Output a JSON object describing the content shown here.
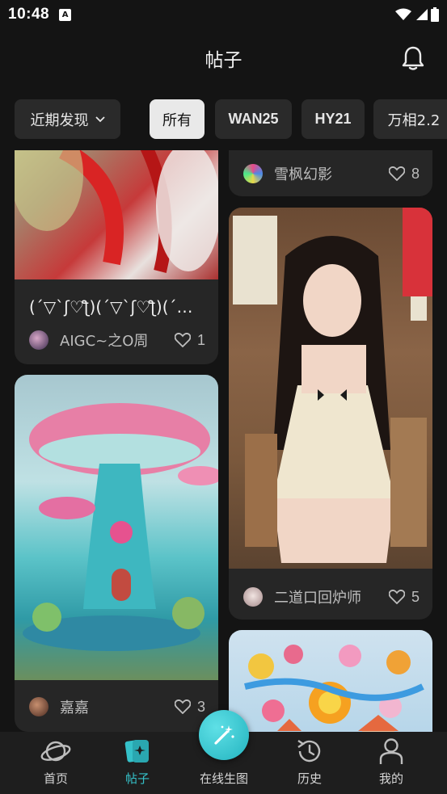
{
  "status_bar": {
    "time": "10:48",
    "app_icon": "A"
  },
  "header": {
    "title": "帖子",
    "notification_icon": "bell-icon"
  },
  "filters": {
    "dropdown_label": "近期发现",
    "chips": [
      "所有",
      "WAN25",
      "HY21",
      "万相2.2"
    ],
    "active_chip": "所有"
  },
  "feed": {
    "left": [
      {
        "caption": "(´▽`ʃ♡ƪ)(´▽`ʃ♡ƪ)(´▽`ʃ♡ƪ)",
        "author": "AIGC~之O周",
        "likes": "1"
      },
      {
        "author": "嘉嘉",
        "likes": "3"
      }
    ],
    "right": [
      {
        "author": "雪枫幻影",
        "likes": "8"
      },
      {
        "author": "二道口回炉师",
        "likes": "5"
      },
      {
        "author": ""
      }
    ]
  },
  "bottom_nav": {
    "items": [
      {
        "label": "首页"
      },
      {
        "label": "帖子"
      },
      {
        "label": "在线生图"
      },
      {
        "label": "历史"
      },
      {
        "label": "我的"
      }
    ],
    "active": "帖子"
  },
  "colors": {
    "accent": "#35c1c9",
    "background": "#141414",
    "card": "#262626"
  }
}
